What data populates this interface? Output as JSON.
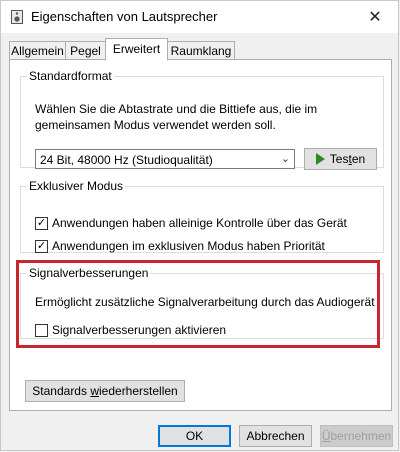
{
  "window": {
    "title": "Eigenschaften von Lautsprecher",
    "icon": "speaker-icon",
    "close_glyph": "✕"
  },
  "tabs": [
    {
      "label": "Allgemein",
      "active": false
    },
    {
      "label": "Pegel",
      "active": false
    },
    {
      "label": "Erweitert",
      "active": true
    },
    {
      "label": "Raumklang",
      "active": false
    }
  ],
  "standardformat": {
    "legend": "Standardformat",
    "description_line1": "Wählen Sie die Abtastrate und die Bittiefe aus, die im",
    "description_line2": "gemeinsamen Modus verwendet werden soll.",
    "selected_value": "24 Bit, 48000 Hz (Studioqualität)",
    "test_button": {
      "icon": "play-icon",
      "label_pre": "Tes",
      "label_accel": "t",
      "label_post": "en",
      "icon_color": "#2a8a2a"
    }
  },
  "exklusiv": {
    "legend": "Exklusiver Modus",
    "options": [
      {
        "label": "Anwendungen haben alleinige Kontrolle über das Gerät",
        "checked": true
      },
      {
        "label": "Anwendungen im exklusiven Modus haben Priorität",
        "checked": true
      }
    ]
  },
  "signal": {
    "legend": "Signalverbesserungen",
    "description": "Ermöglicht zusätzliche Signalverarbeitung durch das Audiogerät",
    "option": {
      "label": "Signalverbesserungen aktivieren",
      "checked": false
    },
    "highlight_color": "#c8262c"
  },
  "restore_button": {
    "label_pre": "Standards ",
    "label_accel": "w",
    "label_post": "iederherstellen"
  },
  "footer": {
    "ok": "OK",
    "cancel": "Abbrechen",
    "apply_accel": "Ü",
    "apply_rest": "bernehmen"
  },
  "colors": {
    "accent": "#0078d7",
    "checkmark_glyph": "✓"
  }
}
